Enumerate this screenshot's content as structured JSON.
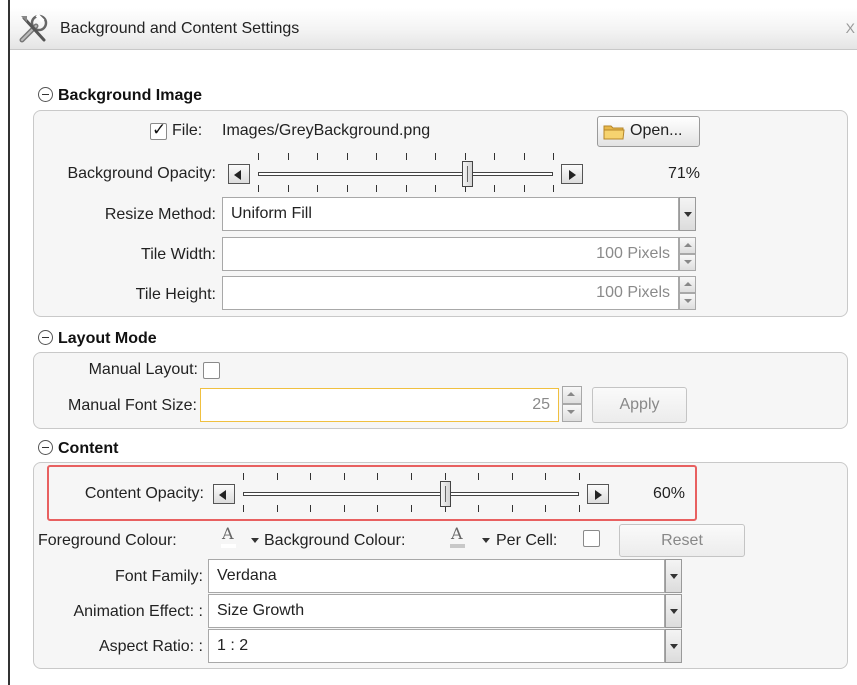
{
  "window": {
    "title": "Background and Content Settings",
    "close_glyph": "X"
  },
  "background_image": {
    "heading": "Background Image",
    "file_checked": true,
    "file_label": "File:",
    "file_value": "Images/GreyBackground.png",
    "open_button": "Open...",
    "opacity_label": "Background Opacity:",
    "opacity_value": "71%",
    "opacity_fraction": 0.71,
    "resize_label": "Resize Method:",
    "resize_value": "Uniform Fill",
    "tile_width_label": "Tile Width:",
    "tile_width_value": "100 Pixels",
    "tile_height_label": "Tile Height:",
    "tile_height_value": "100 Pixels"
  },
  "layout_mode": {
    "heading": "Layout Mode",
    "manual_layout_label": "Manual Layout:",
    "manual_layout_checked": false,
    "font_size_label": "Manual Font Size:",
    "font_size_value": "25",
    "apply_button": "Apply"
  },
  "content": {
    "heading": "Content",
    "opacity_label": "Content Opacity:",
    "opacity_value": "60%",
    "opacity_fraction": 0.6,
    "foreground_label": "Foreground Colour:",
    "foreground_glyph": "A",
    "foreground_color": "#ffffff",
    "background_label": "Background Colour:",
    "background_glyph": "A",
    "background_color": "#c8c8c8",
    "per_cell_label": "Per Cell:",
    "per_cell_checked": false,
    "reset_button": "Reset",
    "font_family_label": "Font Family:",
    "font_family_value": "Verdana",
    "animation_label": "Animation Effect: :",
    "animation_value": "Size Growth",
    "aspect_label": "Aspect Ratio: :",
    "aspect_value": "1 : 2"
  }
}
